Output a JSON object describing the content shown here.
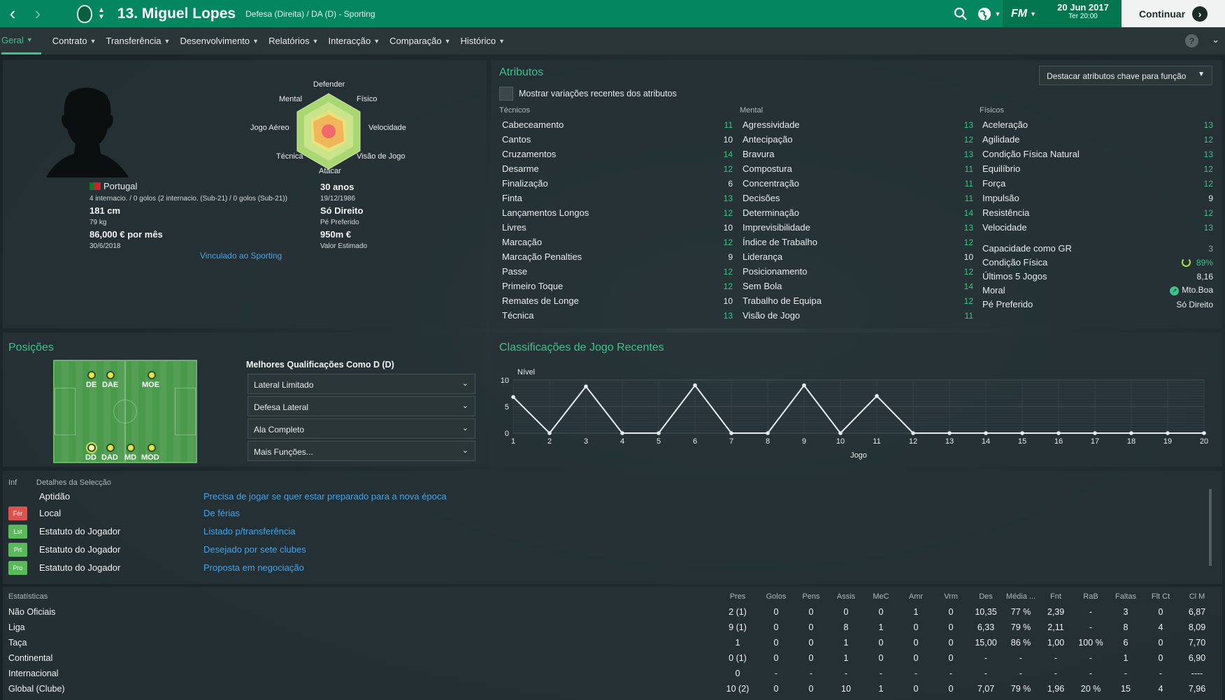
{
  "topbar": {
    "back_icon": "‹",
    "forward_icon": "›",
    "player_name": "13. Miguel Lopes",
    "player_role": "Defesa (Direita) / DA (D) - Sporting",
    "fm_label": "FM",
    "date": "20 Jun 2017",
    "time": "Ter 20:00",
    "continue_label": "Continuar"
  },
  "subnav": {
    "tabs": [
      "Geral",
      "Contrato",
      "Transferência",
      "Desenvolvimento",
      "Relatórios",
      "Interacção",
      "Comparação",
      "Histórico"
    ],
    "help": "?"
  },
  "profile": {
    "nationality": "Portugal",
    "caps": "4 internacio. / 0 golos (2 internacio. (Sub-21) / 0 golos (Sub-21))",
    "height": "181 cm",
    "weight": "79 kg",
    "wage": "86,000 € por mês",
    "contract_end": "30/6/2018",
    "age": "30 anos",
    "dob": "19/12/1986",
    "foot": "Só Direito",
    "foot_label": "Pé Preferido",
    "value": "950m €",
    "value_label": "Valor Estimado",
    "linked": "Vinculado ao Sporting",
    "radar_labels": {
      "defender": "Defender",
      "fisico": "Físico",
      "velocidade": "Velocidade",
      "visao": "Visão de Jogo",
      "atacar": "Atacar",
      "tecnica": "Técnica",
      "jogo_aereo": "Jogo Aéreo",
      "mental": "Mental"
    }
  },
  "attributes": {
    "title": "Atributos",
    "show_variations": "Mostrar variações recentes dos atributos",
    "highlight_dropdown": "Destacar atributos chave para função",
    "tecnicos_head": "Técnicos",
    "mental_head": "Mental",
    "fisicos_head": "Físicos",
    "tecnicos": [
      {
        "name": "Cabeceamento",
        "value": "11"
      },
      {
        "name": "Cantos",
        "value": "10"
      },
      {
        "name": "Cruzamentos",
        "value": "14"
      },
      {
        "name": "Desarme",
        "value": "12"
      },
      {
        "name": "Finalização",
        "value": "6"
      },
      {
        "name": "Finta",
        "value": "13"
      },
      {
        "name": "Lançamentos Longos",
        "value": "12"
      },
      {
        "name": "Livres",
        "value": "10"
      },
      {
        "name": "Marcação",
        "value": "12"
      },
      {
        "name": "Marcação Penalties",
        "value": "9"
      },
      {
        "name": "Passe",
        "value": "12"
      },
      {
        "name": "Primeiro Toque",
        "value": "12"
      },
      {
        "name": "Remates de Longe",
        "value": "10"
      },
      {
        "name": "Técnica",
        "value": "13"
      }
    ],
    "mental": [
      {
        "name": "Agressividade",
        "value": "13"
      },
      {
        "name": "Antecipação",
        "value": "12"
      },
      {
        "name": "Bravura",
        "value": "13"
      },
      {
        "name": "Compostura",
        "value": "11"
      },
      {
        "name": "Concentração",
        "value": "11"
      },
      {
        "name": "Decisões",
        "value": "11"
      },
      {
        "name": "Determinação",
        "value": "14"
      },
      {
        "name": "Imprevisibilidade",
        "value": "13"
      },
      {
        "name": "Índice de Trabalho",
        "value": "12"
      },
      {
        "name": "Liderança",
        "value": "10"
      },
      {
        "name": "Posicionamento",
        "value": "12"
      },
      {
        "name": "Sem Bola",
        "value": "14"
      },
      {
        "name": "Trabalho de Equipa",
        "value": "12"
      },
      {
        "name": "Visão de Jogo",
        "value": "11"
      }
    ],
    "fisicos": [
      {
        "name": "Aceleração",
        "value": "13"
      },
      {
        "name": "Agilidade",
        "value": "12"
      },
      {
        "name": "Condição Física Natural",
        "value": "13"
      },
      {
        "name": "Equilíbrio",
        "value": "12"
      },
      {
        "name": "Força",
        "value": "12"
      },
      {
        "name": "Impulsão",
        "value": "9"
      },
      {
        "name": "Resistência",
        "value": "12"
      },
      {
        "name": "Velocidade",
        "value": "13"
      }
    ],
    "extra": [
      {
        "name": "Capacidade como GR",
        "value": "3"
      },
      {
        "name": "Condição Física",
        "value": "89%"
      },
      {
        "name": "Últimos 5 Jogos",
        "value": "8,16"
      },
      {
        "name": "Moral",
        "value": "Mto.Boa"
      },
      {
        "name": "Pé Preferido",
        "value": "Só Direito"
      }
    ]
  },
  "positions": {
    "title": "Posições",
    "labels": {
      "de": "DE",
      "dae": "DAE",
      "moe": "MOE",
      "dd": "DD",
      "dad": "DAD",
      "md": "MD",
      "mod": "MOD"
    },
    "best_title": "Melhores Qualificações Como D (D)",
    "roles": [
      "Lateral Limitado",
      "Defesa Lateral",
      "Ala Completo",
      "Mais Funções..."
    ]
  },
  "chart_data": {
    "type": "line",
    "title": "Classificações de Jogo Recentes",
    "ylabel": "Nível",
    "xlabel": "Jogo",
    "ylim": [
      0,
      10
    ],
    "yticks": [
      0,
      5,
      10
    ],
    "x": [
      1,
      2,
      3,
      4,
      5,
      6,
      7,
      8,
      9,
      10,
      11,
      12,
      13,
      14,
      15,
      16,
      17,
      18,
      19,
      20
    ],
    "values": [
      6.8,
      0,
      8.8,
      0,
      0,
      9.0,
      0,
      0,
      9.0,
      0,
      7.0,
      0,
      0,
      0,
      0,
      0,
      0,
      0,
      0,
      0
    ],
    "grid": true
  },
  "info": {
    "head_inf": "Inf",
    "head_details": "Detalhes da Selecção",
    "rows": [
      {
        "badge": "",
        "field": "Aptidão",
        "detail": "Precisa de jogar se quer estar preparado para a nova época"
      },
      {
        "badge": "Fér",
        "field": "Local",
        "detail": "De férias"
      },
      {
        "badge": "Lst",
        "field": "Estatuto do Jogador",
        "detail": "Listado p/transferência"
      },
      {
        "badge": "Prt",
        "field": "Estatuto do Jogador",
        "detail": "Desejado por sete clubes"
      },
      {
        "badge": "Pro",
        "field": "Estatuto do Jogador",
        "detail": "Proposta em negociação"
      }
    ],
    "badge_colors": {
      "Fér": "#d9534f",
      "Lst": "#5cb85c",
      "Prt": "#5cb85c",
      "Pro": "#5cb85c"
    }
  },
  "stats": {
    "label": "Estatísticas",
    "columns": [
      "Pres",
      "Golos",
      "Pens",
      "Assis",
      "MeC",
      "Amr",
      "Vrm",
      "Des",
      "Média ...",
      "Fnt",
      "RaB",
      "Faltas",
      "Flt Ct",
      "Cl M"
    ],
    "rows": [
      {
        "name": "Não Oficiais",
        "cells": [
          "2 (1)",
          "0",
          "0",
          "0",
          "0",
          "1",
          "0",
          "10,35",
          "77 %",
          "2,39",
          "-",
          "3",
          "0",
          "6,87"
        ]
      },
      {
        "name": "Liga",
        "cells": [
          "9 (1)",
          "0",
          "0",
          "8",
          "1",
          "0",
          "0",
          "6,33",
          "79 %",
          "2,11",
          "-",
          "8",
          "4",
          "8,09"
        ]
      },
      {
        "name": "Taça",
        "cells": [
          "1",
          "0",
          "0",
          "1",
          "0",
          "0",
          "0",
          "15,00",
          "86 %",
          "1,00",
          "100 %",
          "6",
          "0",
          "7,70"
        ]
      },
      {
        "name": "Continental",
        "cells": [
          "0 (1)",
          "0",
          "0",
          "1",
          "0",
          "0",
          "0",
          "-",
          "-",
          "-",
          "-",
          "1",
          "0",
          "6,90"
        ]
      },
      {
        "name": "Internacional",
        "cells": [
          "0",
          "-",
          "-",
          "-",
          "-",
          "-",
          "-",
          "-",
          "-",
          "-",
          "-",
          "-",
          "-",
          "----"
        ]
      },
      {
        "name": "Global (Clube)",
        "cells": [
          "10 (2)",
          "0",
          "0",
          "10",
          "1",
          "0",
          "0",
          "7,07",
          "79 %",
          "1,96",
          "20 %",
          "15",
          "4",
          "7,96"
        ]
      }
    ]
  }
}
